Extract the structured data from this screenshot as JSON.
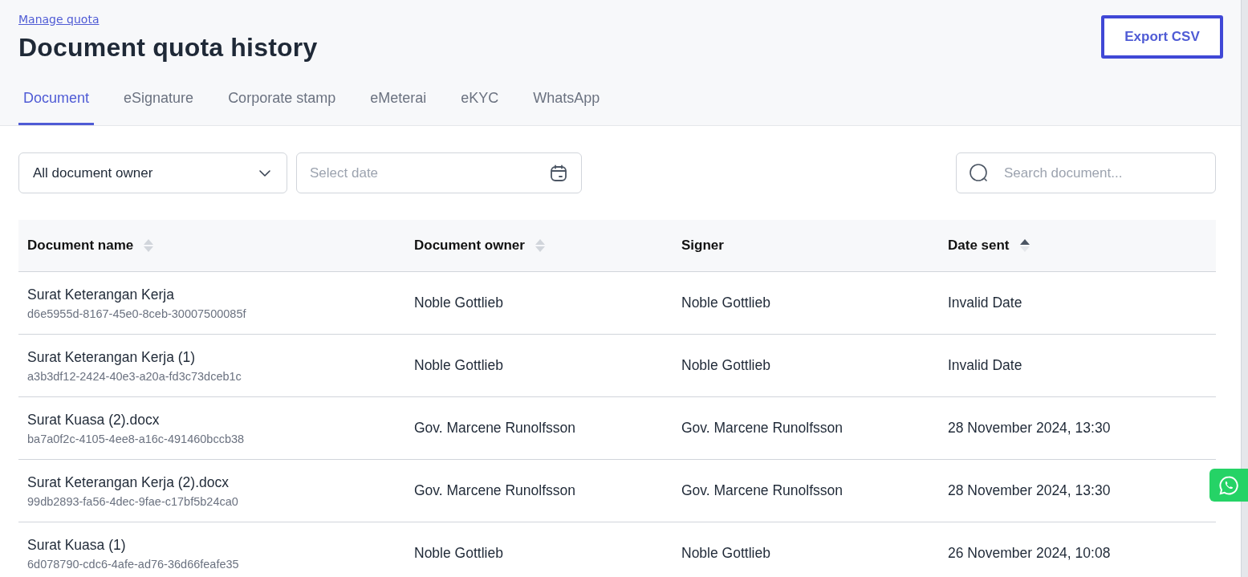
{
  "breadcrumb": {
    "label": "Manage quota"
  },
  "title": "Document quota history",
  "export_button": {
    "label": "Export CSV"
  },
  "tabs": [
    {
      "label": "Document",
      "selected": true
    },
    {
      "label": "eSignature",
      "selected": false
    },
    {
      "label": "Corporate stamp",
      "selected": false
    },
    {
      "label": "eMeterai",
      "selected": false
    },
    {
      "label": "eKYC",
      "selected": false
    },
    {
      "label": "WhatsApp",
      "selected": false
    }
  ],
  "filters": {
    "owner_dropdown": {
      "value": "All document owner"
    },
    "date_field": {
      "placeholder": "Select date"
    },
    "search": {
      "placeholder": "Search document..."
    }
  },
  "table": {
    "columns": [
      {
        "label": "Document name",
        "sortable": true,
        "sorted": false
      },
      {
        "label": "Document owner",
        "sortable": true,
        "sorted": false
      },
      {
        "label": "Signer",
        "sortable": false
      },
      {
        "label": "Date sent",
        "sortable": true,
        "sorted": true
      }
    ],
    "rows": [
      {
        "name": "Surat Keterangan Kerja",
        "id": "d6e5955d-8167-45e0-8ceb-30007500085f",
        "owner": "Noble Gottlieb",
        "signer": "Noble Gottlieb",
        "date": "Invalid Date"
      },
      {
        "name": "Surat Keterangan Kerja (1)",
        "id": "a3b3df12-2424-40e3-a20a-fd3c73dceb1c",
        "owner": "Noble Gottlieb",
        "signer": "Noble Gottlieb",
        "date": "Invalid Date"
      },
      {
        "name": "Surat Kuasa (2).docx",
        "id": "ba7a0f2c-4105-4ee8-a16c-491460bccb38",
        "owner": "Gov. Marcene Runolfsson",
        "signer": "Gov. Marcene Runolfsson",
        "date": "28 November 2024, 13:30"
      },
      {
        "name": "Surat Keterangan Kerja (2).docx",
        "id": "99db2893-fa56-4dec-9fae-c17bf5b24ca0",
        "owner": "Gov. Marcene Runolfsson",
        "signer": "Gov. Marcene Runolfsson",
        "date": "28 November 2024, 13:30"
      },
      {
        "name": "Surat Kuasa (1)",
        "id": "6d078790-cdc6-4afe-ad76-36d66feafe35",
        "owner": "Noble Gottlieb",
        "signer": "Noble Gottlieb",
        "date": "26 November 2024, 10:08"
      }
    ]
  }
}
